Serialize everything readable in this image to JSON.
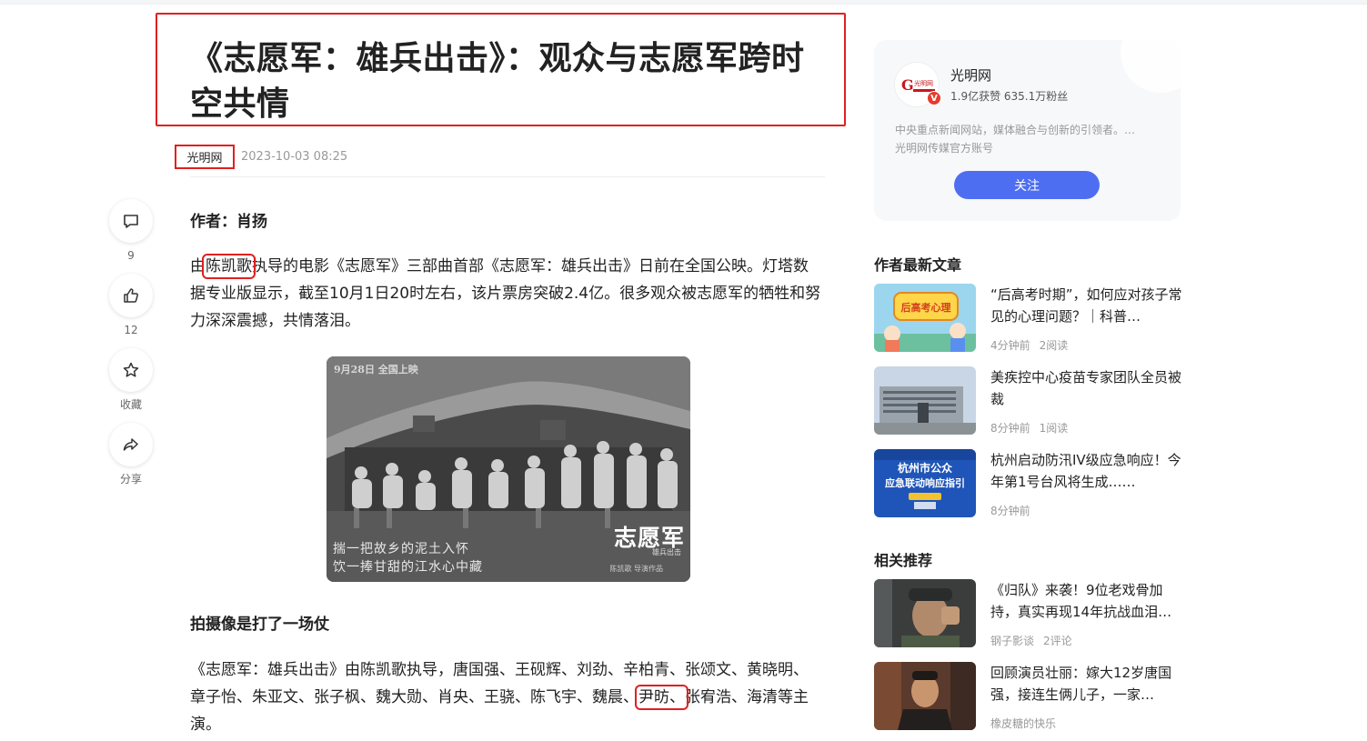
{
  "article": {
    "title": "《志愿军：雄兵出击》：观众与志愿军跨时空共情",
    "source": "光明网",
    "time": "2023-10-03 08:25",
    "author": "作者：肖扬",
    "para1_a": "由",
    "para1_hl": "陈凯歌",
    "para1_b": "执导的电影《志愿军》三部曲首部《志愿军：雄兵出击》日前在全国公映。灯塔数据专业版显示，截至10月1日20时左右，该片票房突破2.4亿。很多观众被志愿军的牺牲和努力深深震撼，共情落泪。",
    "subhead": "拍摄像是打了一场仗",
    "para2_a": "《志愿军：雄兵出击》由陈凯歌执导，唐国强、王砚辉、刘劲、辛柏青、张颂文、黄晓明、章子怡、朱亚文、张子枫、魏大勋、肖央、王骁、陈飞宇、魏晨、",
    "para2_hl": "尹昉、",
    "para2_b": "张宥浩、海清等主演。",
    "poster": {
      "date": "9月28日 全国上映",
      "title": "志愿军",
      "subtitle": "雄兵出击",
      "poem_line1": "揣一把故乡的泥土入怀",
      "poem_line2": "饮一捧甘甜的江水心中藏",
      "credit": "陈凯歌 导演作品"
    }
  },
  "rail": {
    "comment_count": "9",
    "like_count": "12",
    "collect_label": "收藏",
    "share_label": "分享"
  },
  "profile": {
    "name": "光明网",
    "stats": "1.9亿获赞 635.1万粉丝",
    "desc1": "中央重点新闻网站，媒体融合与创新的引领者。…",
    "desc2": "光明网传媒官方账号",
    "follow": "关注",
    "verified_mark": "V",
    "logo_text": "光明网"
  },
  "latest": {
    "title": "作者最新文章",
    "items": [
      {
        "title": "“后高考时期”，如何应对孩子常见的心理问题？｜科普…",
        "time": "4分钟前",
        "reads": "2阅读",
        "thumb_text": "后高考心理"
      },
      {
        "title": "美疾控中心疫苗专家团队全员被裁",
        "time": "8分钟前",
        "reads": "1阅读"
      },
      {
        "title": "杭州启动防汛IV级应急响应！今年第1号台风将生成……",
        "time": "8分钟前",
        "reads": "",
        "thumb_line1": "杭州市公众",
        "thumb_line2": "应急联动响应指引"
      }
    ]
  },
  "related": {
    "title": "相关推荐",
    "items": [
      {
        "title": "《归队》来袭！9位老戏骨加持，真实再现14年抗战血泪…",
        "source": "钢子影谈",
        "comments": "2评论"
      },
      {
        "title": "回顾演员壮丽：嫁大12岁唐国强，接连生俩儿子，一家…",
        "source": "橡皮糖的快乐",
        "comments": ""
      }
    ]
  },
  "colors": {
    "accent": "#4e6ef2",
    "highlight_box": "#e02020"
  }
}
